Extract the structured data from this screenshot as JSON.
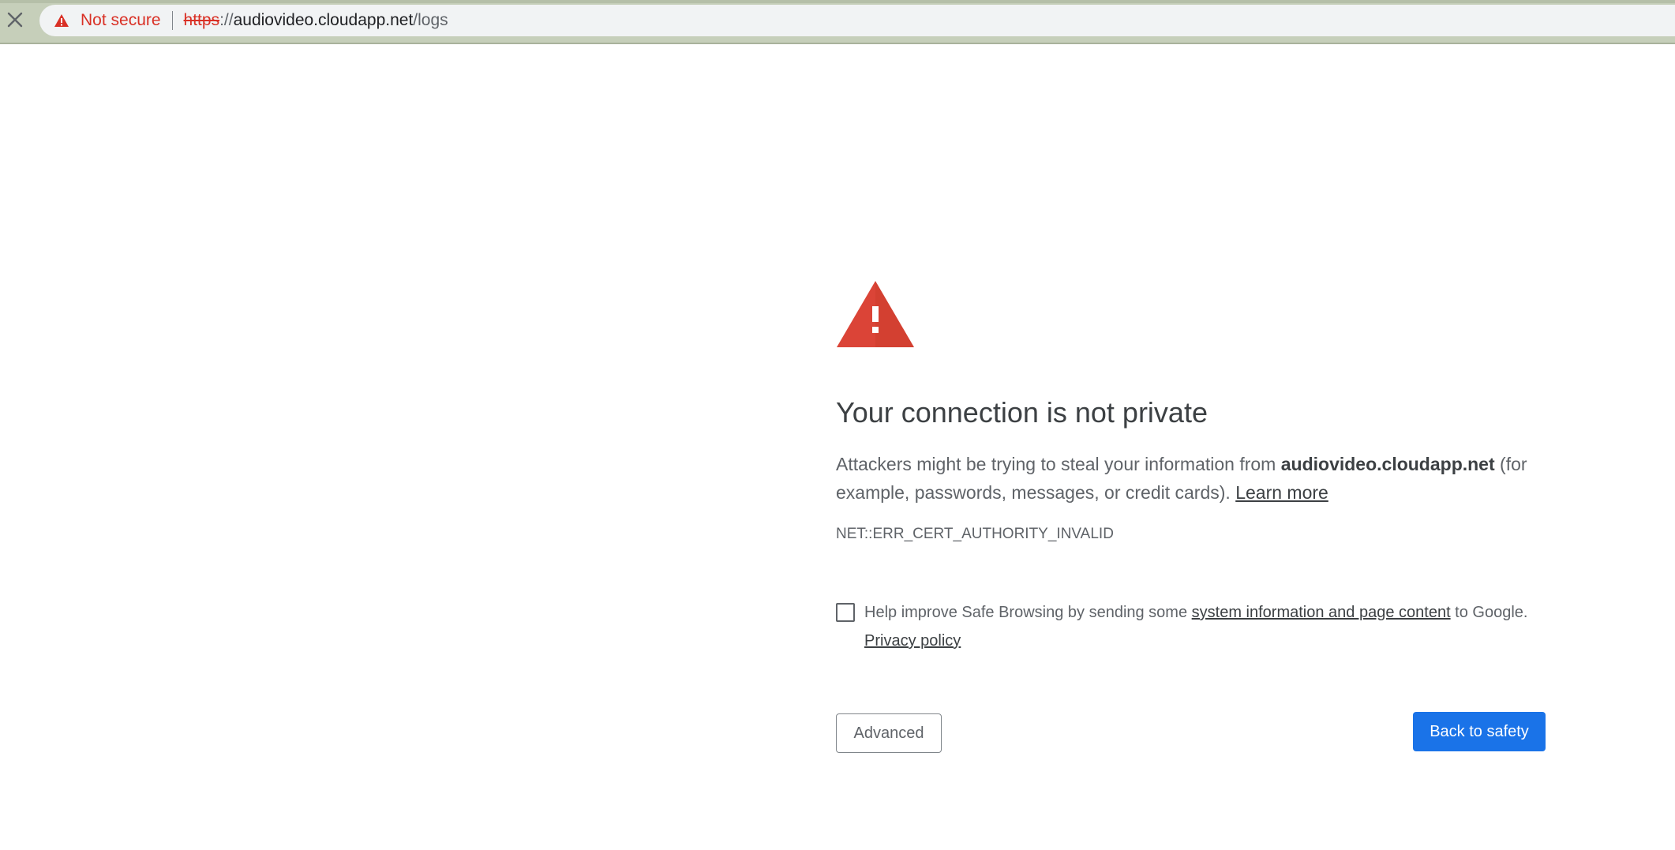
{
  "browser": {
    "security_label": "Not secure",
    "url_scheme": "https",
    "url_scheme_sep": "://",
    "url_host": "audiovideo.cloudapp.net",
    "url_path": "/logs",
    "icons": {
      "close": "close-icon",
      "security": "warning-triangle-icon"
    }
  },
  "interstitial": {
    "heading": "Your connection is not private",
    "description_before": "Attackers might be trying to steal your information from ",
    "description_host": "audiovideo.cloudapp.net",
    "description_after": " (for example, passwords, messages, or credit cards). ",
    "learn_more": "Learn more",
    "error_code": "NET::ERR_CERT_AUTHORITY_INVALID",
    "opt_in_before": "Help improve Safe Browsing by sending some ",
    "opt_in_link": "system information and page content",
    "opt_in_after": " to Google. ",
    "privacy_policy": "Privacy policy",
    "checkbox_checked": false,
    "advanced_button": "Advanced",
    "back_button": "Back to safety",
    "icon": "large-warning-triangle-icon"
  },
  "colors": {
    "warning_red": "#d93025",
    "primary_blue": "#1a73e8",
    "chrome_frame": "#c6cfba",
    "text_gray": "#5f6368"
  }
}
